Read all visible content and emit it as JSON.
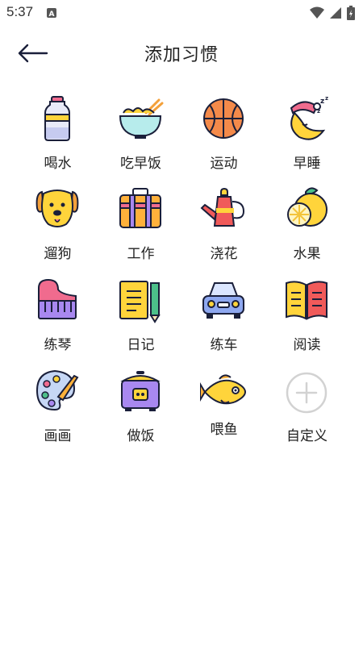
{
  "status": {
    "time": "5:37"
  },
  "header": {
    "title": "添加习惯"
  },
  "habits": [
    {
      "label": "喝水",
      "icon": "water-bottle-icon"
    },
    {
      "label": "吃早饭",
      "icon": "noodle-bowl-icon"
    },
    {
      "label": "运动",
      "icon": "basketball-icon"
    },
    {
      "label": "早睡",
      "icon": "sleeping-moon-icon"
    },
    {
      "label": "遛狗",
      "icon": "dog-icon"
    },
    {
      "label": "工作",
      "icon": "briefcase-icon"
    },
    {
      "label": "浇花",
      "icon": "watering-can-icon"
    },
    {
      "label": "水果",
      "icon": "lemon-icon"
    },
    {
      "label": "练琴",
      "icon": "piano-icon"
    },
    {
      "label": "日记",
      "icon": "diary-icon"
    },
    {
      "label": "练车",
      "icon": "car-icon"
    },
    {
      "label": "阅读",
      "icon": "book-icon"
    },
    {
      "label": "画画",
      "icon": "palette-icon"
    },
    {
      "label": "做饭",
      "icon": "rice-cooker-icon"
    },
    {
      "label": "喂鱼",
      "icon": "fish-icon"
    },
    {
      "label": "自定义",
      "icon": "add-circle-icon"
    }
  ]
}
